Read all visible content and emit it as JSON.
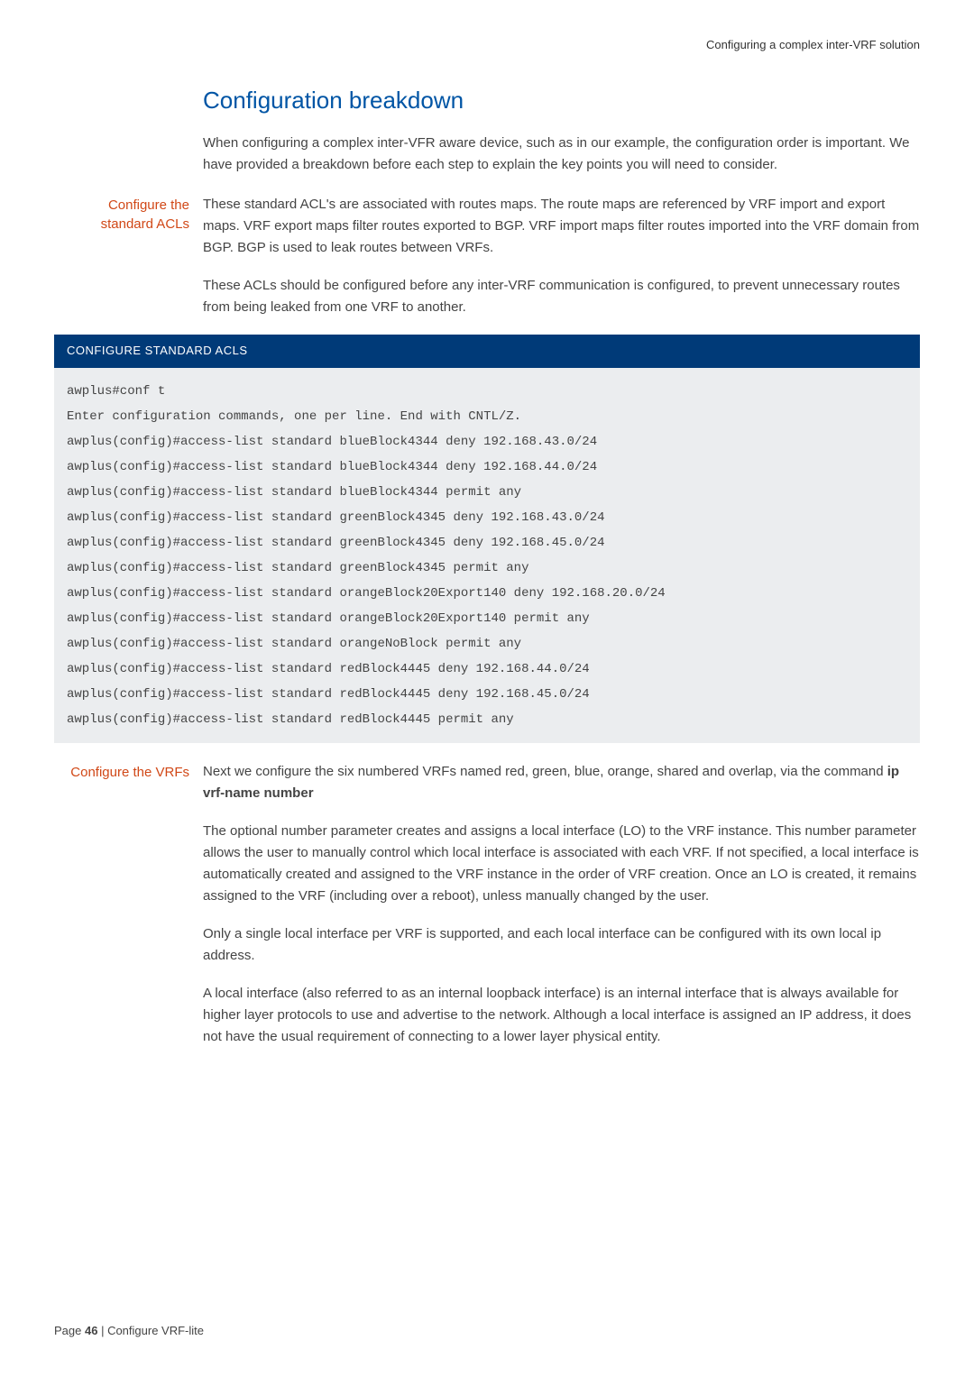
{
  "header": {
    "right_text": "Configuring a complex inter-VRF solution"
  },
  "section": {
    "title": "Configuration breakdown",
    "intro": "When configuring a complex inter-VFR aware device, such as in our example, the configuration order is important. We have provided a breakdown before each step to explain the key points you will need to consider."
  },
  "block1": {
    "sidebar": "Configure the standard ACLs",
    "para1": "These standard ACL's are associated with routes maps. The route maps are referenced by VRF import and export maps. VRF export maps filter routes exported to BGP. VRF import maps filter routes imported into the VRF domain from BGP. BGP is used to leak routes between VRFs.",
    "para2": "These ACLs should be configured before any inter-VRF communication is configured, to prevent unnecessary routes from being leaked from one VRF to another."
  },
  "code": {
    "header": "CONFIGURE STANDARD ACLS",
    "lines": [
      "awplus#conf t",
      "Enter configuration commands, one per line. End with CNTL/Z.",
      "awplus(config)#access-list standard blueBlock4344 deny 192.168.43.0/24",
      "awplus(config)#access-list standard blueBlock4344 deny 192.168.44.0/24",
      "awplus(config)#access-list standard blueBlock4344 permit any",
      "awplus(config)#access-list standard greenBlock4345 deny 192.168.43.0/24",
      "awplus(config)#access-list standard greenBlock4345 deny 192.168.45.0/24",
      "awplus(config)#access-list standard greenBlock4345 permit any",
      "awplus(config)#access-list standard orangeBlock20Export140 deny 192.168.20.0/24",
      "awplus(config)#access-list standard orangeBlock20Export140 permit any",
      "awplus(config)#access-list standard orangeNoBlock permit any",
      "awplus(config)#access-list standard redBlock4445 deny 192.168.44.0/24",
      "awplus(config)#access-list standard redBlock4445 deny 192.168.45.0/24",
      "awplus(config)#access-list standard redBlock4445 permit any"
    ]
  },
  "block2": {
    "sidebar": "Configure the VRFs",
    "para1_prefix": "Next we configure the six numbered VRFs named red, green, blue, orange, shared and overlap, via the command ",
    "para1_bold": "ip vrf-name number",
    "para2": "The optional number parameter creates and assigns a local interface (LO) to the VRF instance. This number parameter allows the user to manually control which local interface is associated with each VRF. If not specified, a local interface is automatically created and assigned to the VRF instance in the order of VRF creation. Once an LO is created, it remains assigned to the VRF (including over a reboot), unless manually changed by the user.",
    "para3": "Only a single local interface per VRF is supported, and each local interface can be configured with its own local ip address.",
    "para4": "A local interface (also referred to as an internal loopback interface) is an internal interface that is always available for higher layer protocols to use and advertise to the network. Although a local interface is assigned an IP address, it does not have the usual requirement of connecting to a lower layer physical entity."
  },
  "footer": {
    "page_label": "Page ",
    "page_number": "46",
    "separator": " | ",
    "doc_title": "Configure VRF-lite"
  }
}
